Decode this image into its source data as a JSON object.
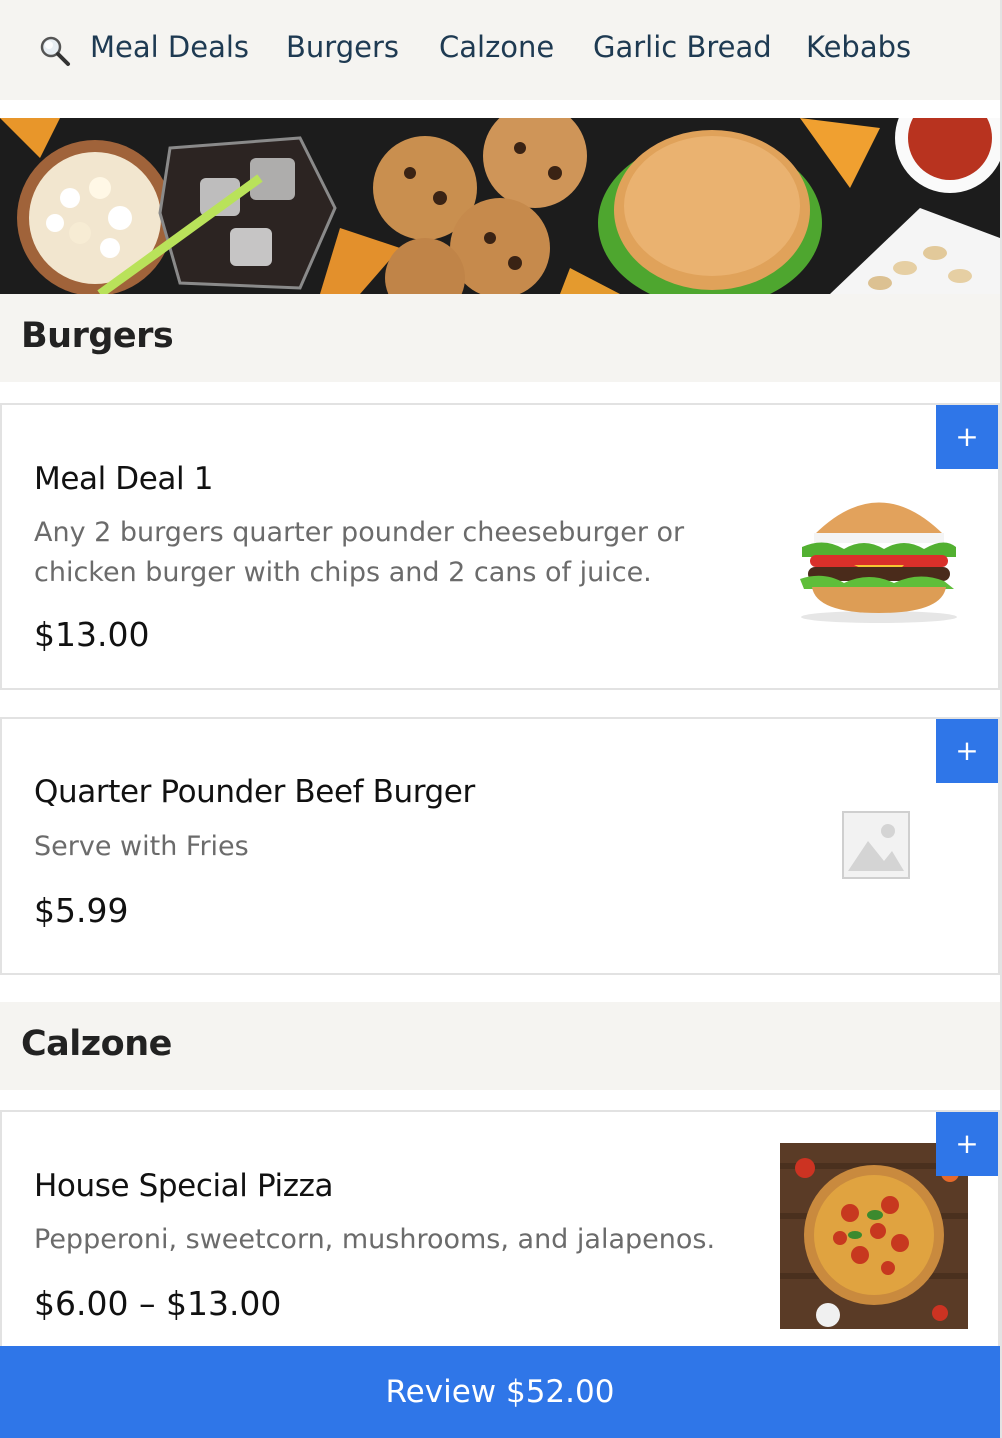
{
  "nav": {
    "search_icon": "search-icon",
    "items": [
      "Meal Deals",
      "Burgers",
      "Calzone",
      "Garlic Bread",
      "Kebabs"
    ]
  },
  "sections": {
    "burgers": "Burgers",
    "calzone": "Calzone"
  },
  "products": [
    {
      "title": "Meal Deal 1",
      "desc_line1": "Any 2 burgers quarter pounder cheeseburger or",
      "desc_line2": "chicken burger with chips and 2 cans of juice.",
      "price": "$13.00",
      "add_label": "+"
    },
    {
      "title": "Quarter Pounder Beef Burger",
      "desc_line1": "Serve with Fries",
      "price": "$5.99",
      "add_label": "+"
    },
    {
      "title": "House Special Pizza",
      "desc_line1": "Pepperoni, sweetcorn, mushrooms, and jalapenos.",
      "price": "$6.00 – $13.00",
      "add_label": "+"
    }
  ],
  "review": {
    "label": "Review $52.00"
  },
  "colors": {
    "accent": "#2f76e8",
    "nav_text": "#1e3a52",
    "section_bg": "#f5f4f1"
  }
}
